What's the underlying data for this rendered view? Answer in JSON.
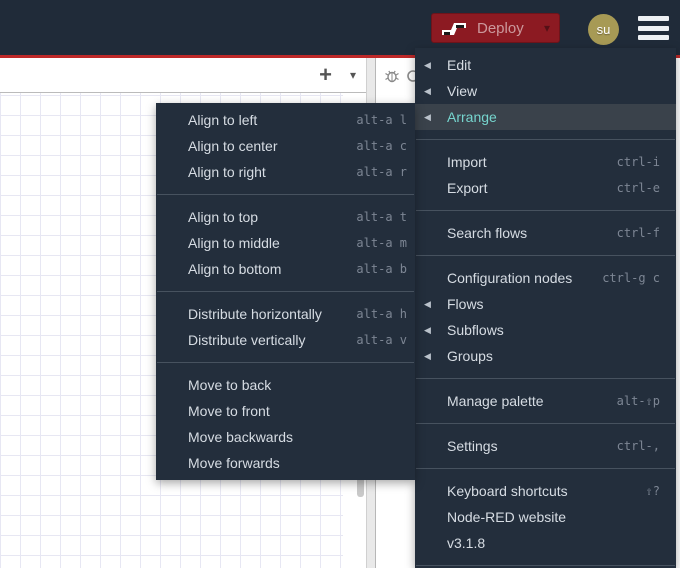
{
  "header": {
    "deploy_label": "Deploy",
    "avatar_initials": "su"
  },
  "icons": {
    "plus": "+",
    "chevron_down": "▾",
    "submenu_arrow": "◀"
  },
  "main_menu": {
    "items": [
      {
        "type": "item",
        "label": "Edit",
        "submenu": true
      },
      {
        "type": "item",
        "label": "View",
        "submenu": true
      },
      {
        "type": "item",
        "label": "Arrange",
        "submenu": true,
        "selected": true
      },
      {
        "type": "separator"
      },
      {
        "type": "item",
        "label": "Import",
        "shortcut": "ctrl-i"
      },
      {
        "type": "item",
        "label": "Export",
        "shortcut": "ctrl-e"
      },
      {
        "type": "separator"
      },
      {
        "type": "item",
        "label": "Search flows",
        "shortcut": "ctrl-f"
      },
      {
        "type": "separator"
      },
      {
        "type": "item",
        "label": "Configuration nodes",
        "shortcut": "ctrl-g c"
      },
      {
        "type": "item",
        "label": "Flows",
        "submenu": true
      },
      {
        "type": "item",
        "label": "Subflows",
        "submenu": true
      },
      {
        "type": "item",
        "label": "Groups",
        "submenu": true
      },
      {
        "type": "separator"
      },
      {
        "type": "item",
        "label": "Manage palette",
        "shortcut": "alt-⇧p"
      },
      {
        "type": "separator"
      },
      {
        "type": "item",
        "label": "Settings",
        "shortcut": "ctrl-,"
      },
      {
        "type": "separator"
      },
      {
        "type": "item",
        "label": "Keyboard shortcuts",
        "shortcut": "⇧?"
      },
      {
        "type": "item",
        "label": "Node-RED website"
      },
      {
        "type": "item",
        "label": "v3.1.8"
      },
      {
        "type": "separator"
      }
    ]
  },
  "submenu": {
    "items": [
      {
        "type": "item",
        "label": "Align to left",
        "shortcut": "alt-a l"
      },
      {
        "type": "item",
        "label": "Align to center",
        "shortcut": "alt-a c"
      },
      {
        "type": "item",
        "label": "Align to right",
        "shortcut": "alt-a r"
      },
      {
        "type": "separator"
      },
      {
        "type": "item",
        "label": "Align to top",
        "shortcut": "alt-a t"
      },
      {
        "type": "item",
        "label": "Align to middle",
        "shortcut": "alt-a m"
      },
      {
        "type": "item",
        "label": "Align to bottom",
        "shortcut": "alt-a b"
      },
      {
        "type": "separator"
      },
      {
        "type": "item",
        "label": "Distribute horizontally",
        "shortcut": "alt-a h"
      },
      {
        "type": "item",
        "label": "Distribute vertically",
        "shortcut": "alt-a v"
      },
      {
        "type": "separator"
      },
      {
        "type": "item",
        "label": "Move to back"
      },
      {
        "type": "item",
        "label": "Move to front"
      },
      {
        "type": "item",
        "label": "Move backwards"
      },
      {
        "type": "item",
        "label": "Move forwards"
      }
    ]
  },
  "colors": {
    "deploy_red": "#8c1a22",
    "header_bg": "#202b39",
    "menu_bg": "#232e3c",
    "menu_highlight_bg": "#3a424b",
    "accent_teal": "#76d5ce",
    "workspace_red_line": "#be2828",
    "avatar_olive": "#a79a55"
  }
}
